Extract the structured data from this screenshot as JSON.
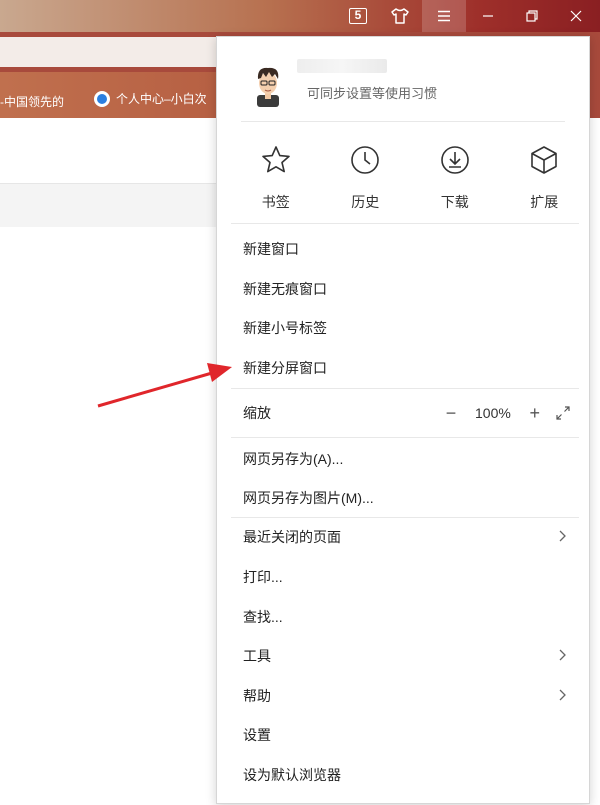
{
  "titlebar": {
    "tab_count": "5"
  },
  "bookmarks": {
    "item1": "-中国领先的",
    "item2": "个人中心–小白次"
  },
  "menu": {
    "sync_hint": "可同步设置等使用习惯",
    "quick": [
      {
        "label": "书签",
        "icon": "star-icon"
      },
      {
        "label": "历史",
        "icon": "clock-icon"
      },
      {
        "label": "下载",
        "icon": "download-icon"
      },
      {
        "label": "扩展",
        "icon": "cube-icon"
      }
    ],
    "new_window": "新建窗口",
    "new_incognito": "新建无痕窗口",
    "new_small_tab": "新建小号标签",
    "new_split": "新建分屏窗口",
    "zoom_label": "缩放",
    "zoom_value": "100%",
    "save_as": "网页另存为(A)...",
    "save_as_image": "网页另存为图片(M)...",
    "recently_closed": "最近关闭的页面",
    "print": "打印...",
    "find": "查找...",
    "tools": "工具",
    "help": "帮助",
    "settings": "设置",
    "set_default": "设为默认浏览器"
  },
  "colors": {
    "accent_red": "#e0262b",
    "titlebar_dark": "#8a1f22"
  }
}
